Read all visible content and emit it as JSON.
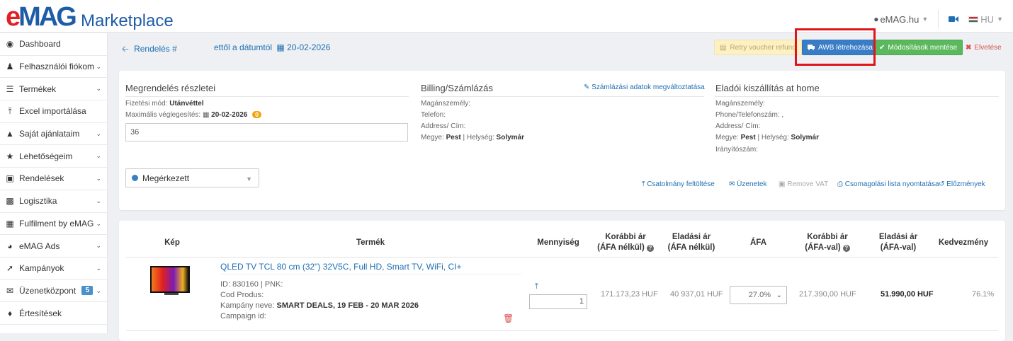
{
  "header": {
    "logo_text": "eMAG",
    "logo_sub": "Marketplace",
    "site": "eMAG.hu",
    "language": "HU"
  },
  "sidebar": {
    "items": [
      {
        "label": "Dashboard",
        "icon": "dashboard-icon",
        "chevron": false
      },
      {
        "label": "Felhasználói fiókom",
        "icon": "user-icon",
        "chevron": true
      },
      {
        "label": "Termékek",
        "icon": "list-icon",
        "chevron": true
      },
      {
        "label": "Excel importálása",
        "icon": "upload-icon",
        "chevron": false
      },
      {
        "label": "Saját ajánlataim",
        "icon": "chart-area-icon",
        "chevron": true
      },
      {
        "label": "Lehetőségeim",
        "icon": "star-icon",
        "chevron": true
      },
      {
        "label": "Rendelések",
        "icon": "cart-icon",
        "chevron": true
      },
      {
        "label": "Logisztika",
        "icon": "truck-icon",
        "chevron": true
      },
      {
        "label": "Fulfilment by eMAG",
        "icon": "boxes-icon",
        "chevron": true
      },
      {
        "label": "eMAG Ads",
        "icon": "pie-chart-icon",
        "chevron": true
      },
      {
        "label": "Kampányok",
        "icon": "line-chart-icon",
        "chevron": true
      },
      {
        "label": "Üzenetközpont",
        "icon": "envelope-icon",
        "chevron": true,
        "badge": "5"
      },
      {
        "label": "Értesítések",
        "icon": "bell-icon",
        "chevron": false
      }
    ]
  },
  "actions": {
    "back": "Rendelés #",
    "date_label": "ettől a dátumtól",
    "date_value": "20-02-2026",
    "retry": "Retry voucher refund",
    "awb": "AWB létrehozása",
    "save": "Módosítások mentése",
    "reject": "Elvetése"
  },
  "order": {
    "details_title": "Megrendelés részletei",
    "payment_label": "Fizetési mód:",
    "payment_value": "Utánvéttel",
    "max_final_label": "Maximális véglegesítés:",
    "max_final_value": "20-02-2026",
    "max_final_badge": "0",
    "note_value": "36",
    "billing_title": "Billing/Számlázás",
    "edit_billing": "Számlázási adatok megváltoztatása",
    "billing": {
      "person": "Magánszemély:",
      "phone": "Telefon:",
      "address": "Address/ Cím:",
      "county_label": "Megye:",
      "county": "Pest",
      "city_label": "Helység:",
      "city": "Solymár"
    },
    "delivery_title": "Eladói kiszállítás at home",
    "delivery": {
      "person": "Magánszemély:",
      "phone": "Phone/Telefonszám: ,",
      "address": "Address/ Cím:",
      "county_label": "Megye:",
      "county": "Pest",
      "city_label": "Helység:",
      "city": "Solymár",
      "zip": "Irányítószám:"
    },
    "status": "Megérkezett",
    "links": {
      "attach": "Csatolmány feltöltése",
      "messages": "Üzenetek",
      "remove_vat": "Remove VAT",
      "print": "Csomagolási lista nyomtatása",
      "history": "Előzmények"
    }
  },
  "products": {
    "headers": {
      "image": "Kép",
      "product": "Termék",
      "qty": "Mennyiség",
      "prev_net_1": "Korábbi ár",
      "prev_net_2": "(ÁFA nélkül)",
      "sale_net_1": "Eladási ár",
      "sale_net_2": "(ÁFA nélkül)",
      "vat": "ÁFA",
      "prev_gross_1": "Korábbi ár",
      "prev_gross_2": "(ÁFA-val)",
      "sale_gross_1": "Eladási ár",
      "sale_gross_2": "(ÁFA-val)",
      "discount": "Kedvezmény"
    },
    "row": {
      "name": "QLED TV TCL 80 cm (32\") 32V5C, Full HD, Smart TV, WiFi, CI+",
      "id_line": "ID: 830160 | PNK:",
      "cod": "Cod Produs:",
      "campaign_label": "Kampány neve:",
      "campaign": "SMART DEALS, 19 FEB - 20 MAR 2026",
      "campaign_id": "Campaign id:",
      "qty": "1",
      "prev_net": "171.173,23 HUF",
      "sale_net": "40 937,01 HUF",
      "vat": "27.0%",
      "prev_gross": "217.390,00 HUF",
      "sale_gross": "51.990,00 HUF",
      "discount": "76.1%"
    }
  },
  "colors": {
    "brand_blue": "#1e5ca8",
    "brand_red": "#e31e24",
    "link": "#1e6fb3",
    "awb_button": "#3a7dc7",
    "save_button": "#5cb85c",
    "highlight": "#e0141c"
  }
}
